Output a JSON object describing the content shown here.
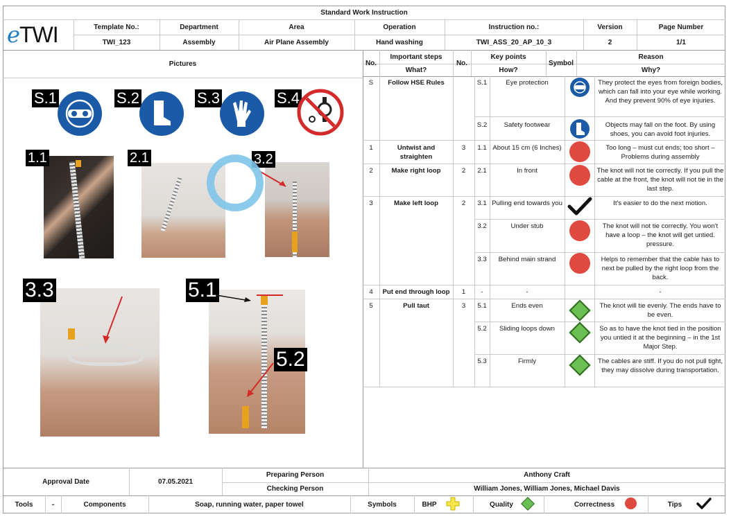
{
  "doc_title": "Standard Work Instruction",
  "logo": {
    "e": "e",
    "twi": "TWI"
  },
  "header": {
    "labels": [
      "Template No.:",
      "Department",
      "Area",
      "Operation",
      "Instruction no.:",
      "Version",
      "Page Number"
    ],
    "values": [
      "TWI_123",
      "Assembly",
      "Air Plane Assembly",
      "Hand washing",
      "TWI_ASS_20_AP_10_3",
      "2",
      "1/1"
    ]
  },
  "pictures_label": "Pictures",
  "photo_tags": [
    "S.1",
    "S.2",
    "S.3",
    "S.4",
    "1.1",
    "2.1",
    "3.2",
    "3.3",
    "5.1",
    "5.2"
  ],
  "table_header": {
    "no": "No.",
    "important_steps": "Important steps",
    "what": "What?",
    "no2": "No.",
    "key_points": "Key points",
    "how": "How?",
    "symbol": "Symbol",
    "reason": "Reason",
    "why": "Why?"
  },
  "steps": [
    {
      "no": "S",
      "what": "Follow HSE Rules",
      "count": ""
    },
    {
      "no": "1",
      "what": "Untwist and straighten",
      "count": "3"
    },
    {
      "no": "2",
      "what": "Make right loop",
      "count": "2"
    },
    {
      "no": "3",
      "what": "Make left loop",
      "count": "2"
    },
    {
      "no": "4",
      "what": "Put end through loop",
      "count": "1"
    },
    {
      "no": "5",
      "what": "Pull taut",
      "count": "3"
    }
  ],
  "key_points": [
    {
      "no": "S.1",
      "how": "Eye protection",
      "symbol": "eye-protection-sign",
      "why": "They protect the eyes from foreign bodies, which can fall into your eye while working. And they prevent 90% of eye injuries."
    },
    {
      "no": "S.2",
      "how": "Safety footwear",
      "symbol": "safety-footwear-sign",
      "why": "Objects may fall on the foot. By using shoes, you can avoid foot injuries."
    },
    {
      "no": "1.1",
      "how": "About 15 cm (6 Inches)",
      "symbol": "correctness",
      "why": "Too long – must cut ends; too short – Problems during assembly"
    },
    {
      "no": "2.1",
      "how": "In front",
      "symbol": "correctness",
      "why": "The knot will not tie correctly. If you pull the cable at the front, the knot will not tie in the last step."
    },
    {
      "no": "3.1",
      "how": "Pulling end towards you",
      "symbol": "tips",
      "why": "It's easier to do the next motion."
    },
    {
      "no": "3.2",
      "how": "Under stub",
      "symbol": "correctness",
      "why": "The knot will not tie correctly. You won't have a loop – the knot will get untied. pressure."
    },
    {
      "no": "3.3",
      "how": "Behind main strand",
      "symbol": "correctness",
      "why": "Helps to remember that the cable has to next be pulled by the right loop from the back."
    },
    {
      "no": "-",
      "how": "-",
      "symbol": "",
      "why": "-"
    },
    {
      "no": "5.1",
      "how": "Ends even",
      "symbol": "quality",
      "why": "The knot will tie evenly. The ends have to be even."
    },
    {
      "no": "5.2",
      "how": "Sliding loops down",
      "symbol": "quality",
      "why": "So as to have the knot tied in the position you untied it at the beginning – in the 1st Major Step."
    },
    {
      "no": "5.3",
      "how": "Firmly",
      "symbol": "quality",
      "why": "The cables are stiff. If you do not pull tight, they may dissolve during transportation."
    }
  ],
  "footer": {
    "approval_label": "Approval Date",
    "approval_date": "07.05.2021",
    "preparing_label": "Preparing Person",
    "preparing_value": "Anthony Craft",
    "checking_label": "Checking Person",
    "checking_value": "William Jones, William Jones, Michael Davis",
    "tools_label": "Tools",
    "tools_value": "-",
    "components_label": "Components",
    "components_value": "Soap, running water, paper towel",
    "symbols_label": "Symbols",
    "bhp_label": "BHP",
    "quality_label": "Quality",
    "correctness_label": "Correctness",
    "tips_label": "Tips"
  },
  "colors": {
    "correctness": "#e0493f",
    "quality": "#6cbf52",
    "bhp": "#f5e64a",
    "sign_blue": "#1a5aa6",
    "sign_red": "#d42a2a",
    "logo_blue": "#1a7fc2",
    "annotation_circle": "#7fc4ea"
  }
}
